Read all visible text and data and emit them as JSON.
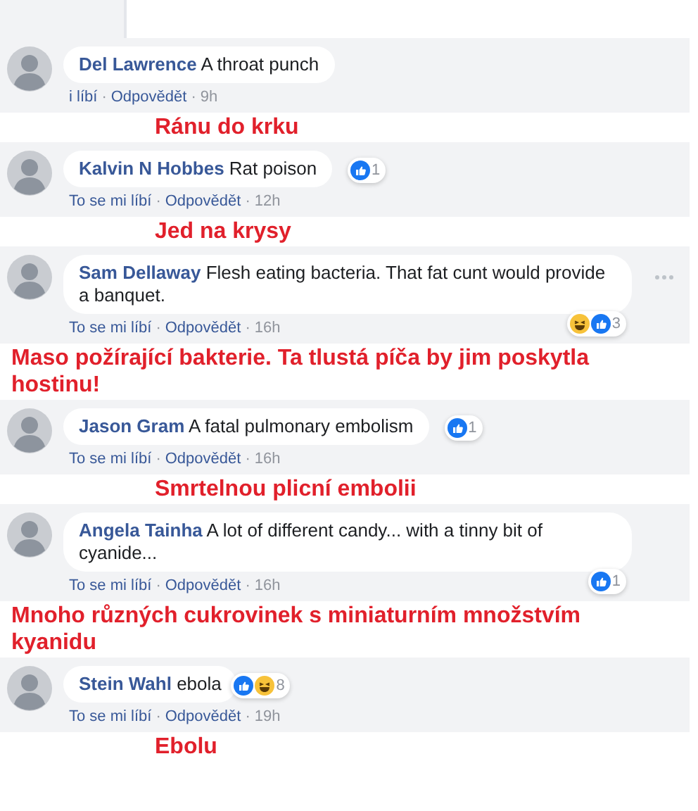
{
  "comments": [
    {
      "name": "Del Lawrence",
      "text": "A throat punch",
      "like": "i líbí",
      "separator": "·",
      "reply": "Odpovědět",
      "time": "9h",
      "translation": "Ránu do krku"
    },
    {
      "name": "Kalvin N Hobbes",
      "text": "Rat poison",
      "like": "To se mi líbí",
      "separator": "·",
      "reply": "Odpovědět",
      "time": "12h",
      "reactions": [
        {
          "kind": "like"
        }
      ],
      "reaction_count": "1",
      "translation": "Jed na krysy"
    },
    {
      "name": "Sam Dellaway",
      "text": "Flesh eating bacteria. That fat cunt would provide a banquet.",
      "like": "To se mi líbí",
      "separator": "·",
      "reply": "Odpovědět",
      "time": "16h",
      "reactions": [
        {
          "kind": "haha"
        },
        {
          "kind": "like"
        }
      ],
      "reaction_count": "3",
      "menu_button": true,
      "translation": "Maso požírající bakterie. Ta tlustá píča by jim poskytla hostinu!"
    },
    {
      "name": "Jason Gram",
      "text": "A fatal pulmonary embolism",
      "like": "To se mi líbí",
      "separator": "·",
      "reply": "Odpovědět",
      "time": "16h",
      "reactions": [
        {
          "kind": "like"
        }
      ],
      "reaction_count": "1",
      "translation": "Smrtelnou plicní embolii"
    },
    {
      "name": "Angela Tainha",
      "text": "A lot of different candy... with a tinny bit of cyanide...",
      "like": "To se mi líbí",
      "separator": "·",
      "reply": "Odpovědět",
      "time": "16h",
      "reactions": [
        {
          "kind": "like"
        }
      ],
      "reaction_count": "1",
      "translation": "Mnoho různých cukrovinek s miniaturním množstvím kyanidu"
    },
    {
      "name": "Stein Wahl",
      "text": "ebola",
      "like": "To se mi líbí",
      "separator": "·",
      "reply": "Odpovědět",
      "time": "19h",
      "reactions": [
        {
          "kind": "like"
        },
        {
          "kind": "haha"
        }
      ],
      "reaction_count": "8",
      "translation": "Ebolu"
    }
  ]
}
